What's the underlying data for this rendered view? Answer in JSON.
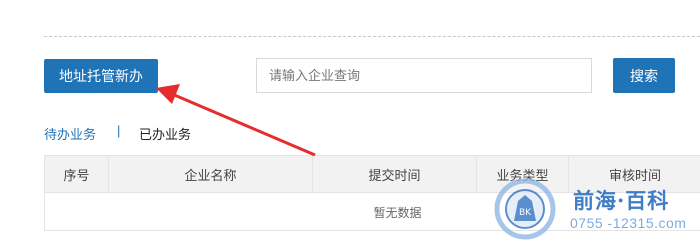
{
  "toolbar": {
    "new_button_label": "地址托管新办",
    "search_placeholder": "请输入企业查询",
    "search_button_label": "搜索"
  },
  "tabs": {
    "pending_label": "待办业务",
    "divider": "|",
    "done_label": "已办业务",
    "active": "done"
  },
  "table": {
    "columns": [
      "序号",
      "企业名称",
      "提交时间",
      "业务类型",
      "审核时间"
    ],
    "empty_text": "暂无数据"
  },
  "watermark": {
    "title": "前海·百科",
    "phone": "0755 -12315.com",
    "logo_text": "BK"
  },
  "colors": {
    "primary": "#1f73b7",
    "annotation_arrow": "#e52d2d",
    "watermark": "#2c6fc2"
  },
  "annotation": {
    "icon": "red-arrow-icon"
  }
}
